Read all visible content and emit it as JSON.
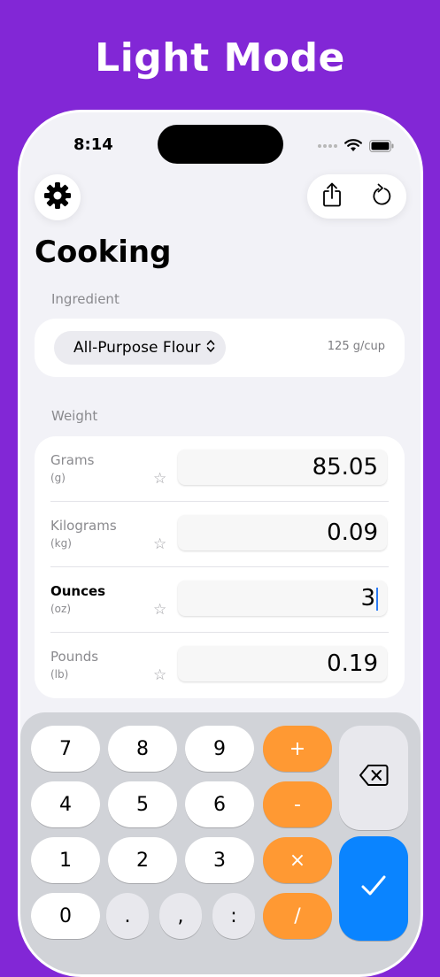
{
  "banner_title": "Light Mode",
  "status": {
    "time": "8:14"
  },
  "header": {
    "title": "Cooking"
  },
  "ingredient_section": {
    "label": "Ingredient",
    "selected": "All-Purpose Flour",
    "density": "125 g/cup"
  },
  "weight_section": {
    "label": "Weight",
    "units": [
      {
        "name": "Grams",
        "abbr": "(g)",
        "value": "85.05",
        "active": false
      },
      {
        "name": "Kilograms",
        "abbr": "(kg)",
        "value": "0.09",
        "active": false
      },
      {
        "name": "Ounces",
        "abbr": "(oz)",
        "value": "3",
        "active": true
      },
      {
        "name": "Pounds",
        "abbr": "(lb)",
        "value": "0.19",
        "active": false
      }
    ]
  },
  "keypad": {
    "row1": [
      "7",
      "8",
      "9",
      "+"
    ],
    "row2": [
      "4",
      "5",
      "6",
      "-"
    ],
    "row3": [
      "1",
      "2",
      "3",
      "×"
    ],
    "row4": [
      "0",
      ".",
      ",",
      ":",
      "/"
    ]
  },
  "icons": {
    "settings": "gear-icon",
    "share": "share-icon",
    "reset": "reset-icon",
    "delete": "backspace-icon",
    "confirm": "checkmark-icon",
    "favorite": "star-icon"
  },
  "colors": {
    "background": "#8227d6",
    "operator": "#ff9933",
    "confirm": "#0a84ff"
  }
}
